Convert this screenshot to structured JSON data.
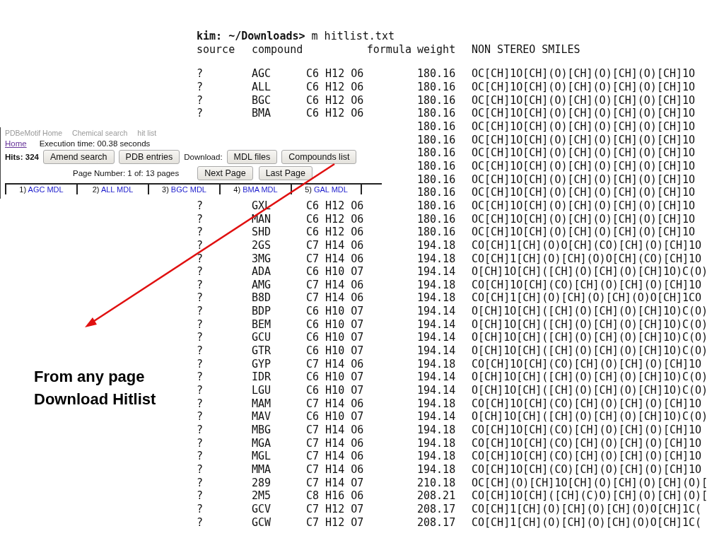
{
  "terminal": {
    "prompt": "**kim: ~/Downloads>** m hitlist.txt",
    "columns": [
      "source",
      "compound",
      "formula",
      "weight",
      "NON STEREO SMILES"
    ],
    "rows": [
      {
        "source": "?",
        "compound": "AGC",
        "formula": "C6 H12 O6",
        "weight": "180.16",
        "smiles": "OC[CH]1O[CH](O)[CH](O)[CH](O)[CH]1O"
      },
      {
        "source": "?",
        "compound": "ALL",
        "formula": "C6 H12 O6",
        "weight": "180.16",
        "smiles": "OC[CH]1O[CH](O)[CH](O)[CH](O)[CH]1O"
      },
      {
        "source": "?",
        "compound": "BGC",
        "formula": "C6 H12 O6",
        "weight": "180.16",
        "smiles": "OC[CH]1O[CH](O)[CH](O)[CH](O)[CH]1O"
      },
      {
        "source": "?",
        "compound": "BMA",
        "formula": "C6 H12 O6",
        "weight": "180.16",
        "smiles": "OC[CH]1O[CH](O)[CH](O)[CH](O)[CH]1O"
      },
      {
        "weight": "180.16",
        "smiles": "OC[CH]1O[CH](O)[CH](O)[CH](O)[CH]1O"
      },
      {
        "weight": "180.16",
        "smiles": "OC[CH]1O[CH](O)[CH](O)[CH](O)[CH]1O"
      },
      {
        "weight": "180.16",
        "smiles": "OC[CH]1O[CH](O)[CH](O)[CH](O)[CH]1O"
      },
      {
        "weight": "180.16",
        "smiles": "OC[CH]1O[CH](O)[CH](O)[CH](O)[CH]1O"
      },
      {
        "weight": "180.16",
        "smiles": "OC[CH]1O[CH](O)[CH](O)[CH](O)[CH]1O"
      },
      {
        "weight": "180.16",
        "smiles": "OC[CH]1O[CH](O)[CH](O)[CH](O)[CH]1O"
      },
      {
        "source": "?",
        "compound": "GXL",
        "formula": "C6 H12 O6",
        "weight": "180.16",
        "smiles": "OC[CH]1O[CH](O)[CH](O)[CH](O)[CH]1O"
      },
      {
        "source": "?",
        "compound": "MAN",
        "formula": "C6 H12 O6",
        "weight": "180.16",
        "smiles": "OC[CH]1O[CH](O)[CH](O)[CH](O)[CH]1O"
      },
      {
        "source": "?",
        "compound": "SHD",
        "formula": "C6 H12 O6",
        "weight": "180.16",
        "smiles": "OC[CH]1O[CH](O)[CH](O)[CH](O)[CH]1O"
      },
      {
        "source": "?",
        "compound": "2GS",
        "formula": "C7 H14 O6",
        "weight": "194.18",
        "smiles": "CO[CH]1[CH](O)O[CH](CO)[CH](O)[CH]1O"
      },
      {
        "source": "?",
        "compound": "3MG",
        "formula": "C7 H14 O6",
        "weight": "194.18",
        "smiles": "CO[CH]1[CH](O)[CH](O)O[CH](CO)[CH]1O"
      },
      {
        "source": "?",
        "compound": "ADA",
        "formula": "C6 H10 O7",
        "weight": "194.14",
        "smiles": "O[CH]1O[CH]([CH](O)[CH](O)[CH]1O)C(O)"
      },
      {
        "source": "?",
        "compound": "AMG",
        "formula": "C7 H14 O6",
        "weight": "194.18",
        "smiles": "CO[CH]1O[CH](CO)[CH](O)[CH](O)[CH]1O"
      },
      {
        "source": "?",
        "compound": "B8D",
        "formula": "C7 H14 O6",
        "weight": "194.18",
        "smiles": "CO[CH]1[CH](O)[CH](O)[CH](O)O[CH]1CO"
      },
      {
        "source": "?",
        "compound": "BDP",
        "formula": "C6 H10 O7",
        "weight": "194.14",
        "smiles": "O[CH]1O[CH]([CH](O)[CH](O)[CH]1O)C(O)"
      },
      {
        "source": "?",
        "compound": "BEM",
        "formula": "C6 H10 O7",
        "weight": "194.14",
        "smiles": "O[CH]1O[CH]([CH](O)[CH](O)[CH]1O)C(O)"
      },
      {
        "source": "?",
        "compound": "GCU",
        "formula": "C6 H10 O7",
        "weight": "194.14",
        "smiles": "O[CH]1O[CH]([CH](O)[CH](O)[CH]1O)C(O)"
      },
      {
        "source": "?",
        "compound": "GTR",
        "formula": "C6 H10 O7",
        "weight": "194.14",
        "smiles": "O[CH]1O[CH]([CH](O)[CH](O)[CH]1O)C(O)"
      },
      {
        "source": "?",
        "compound": "GYP",
        "formula": "C7 H14 O6",
        "weight": "194.18",
        "smiles": "CO[CH]1O[CH](CO)[CH](O)[CH](O)[CH]1O"
      },
      {
        "source": "?",
        "compound": "IDR",
        "formula": "C6 H10 O7",
        "weight": "194.14",
        "smiles": "O[CH]1O[CH]([CH](O)[CH](O)[CH]1O)C(O)"
      },
      {
        "source": "?",
        "compound": "LGU",
        "formula": "C6 H10 O7",
        "weight": "194.14",
        "smiles": "O[CH]1O[CH]([CH](O)[CH](O)[CH]1O)C(O)"
      },
      {
        "source": "?",
        "compound": "MAM",
        "formula": "C7 H14 O6",
        "weight": "194.18",
        "smiles": "CO[CH]1O[CH](CO)[CH](O)[CH](O)[CH]1O"
      },
      {
        "source": "?",
        "compound": "MAV",
        "formula": "C6 H10 O7",
        "weight": "194.14",
        "smiles": "O[CH]1O[CH]([CH](O)[CH](O)[CH]1O)C(O)"
      },
      {
        "source": "?",
        "compound": "MBG",
        "formula": "C7 H14 O6",
        "weight": "194.18",
        "smiles": "CO[CH]1O[CH](CO)[CH](O)[CH](O)[CH]1O"
      },
      {
        "source": "?",
        "compound": "MGA",
        "formula": "C7 H14 O6",
        "weight": "194.18",
        "smiles": "CO[CH]1O[CH](CO)[CH](O)[CH](O)[CH]1O"
      },
      {
        "source": "?",
        "compound": "MGL",
        "formula": "C7 H14 O6",
        "weight": "194.18",
        "smiles": "CO[CH]1O[CH](CO)[CH](O)[CH](O)[CH]1O"
      },
      {
        "source": "?",
        "compound": "MMA",
        "formula": "C7 H14 O6",
        "weight": "194.18",
        "smiles": "CO[CH]1O[CH](CO)[CH](O)[CH](O)[CH]1O"
      },
      {
        "source": "?",
        "compound": "289",
        "formula": "C7 H14 O7",
        "weight": "210.18",
        "smiles": "OC[CH](O)[CH]1O[CH](O)[CH](O)[CH](O)["
      },
      {
        "source": "?",
        "compound": "2M5",
        "formula": "C8 H16 O6",
        "weight": "208.21",
        "smiles": "CO[CH]1O[CH]([CH](C)O)[CH](O)[CH](O)["
      },
      {
        "source": "?",
        "compound": "GCV",
        "formula": "C7 H12 O7",
        "weight": "208.17",
        "smiles": "CO[CH]1[CH](O)[CH](O)[CH](O)O[CH]1C("
      },
      {
        "source": "?",
        "compound": "GCW",
        "formula": "C7 H12 O7",
        "weight": "208.17",
        "smiles": "CO[CH]1[CH](O)[CH](O)[CH](O)O[CH]1C("
      }
    ]
  },
  "web_page": {
    "breadcrumbs": [
      "PDBeMotif Home",
      "Chemical search",
      "hit list"
    ],
    "home_link": "Home",
    "execution_time": "Execution time: 00.38 seconds",
    "hits": "Hits: 324",
    "buttons": [
      "Amend search",
      "PDB entries"
    ],
    "download_label": "Download:",
    "download_buttons": [
      "MDL files",
      "Compounds list"
    ],
    "page_number": "Page Number: 1 of: 13 pages",
    "nav_buttons": [
      "Next Page",
      "Last Page"
    ],
    "results": [
      {
        "number": "1)",
        "link": "AGC MDL"
      },
      {
        "number": "2)",
        "link": "ALL MDL"
      },
      {
        "number": "3)",
        "link": "BGC MDL"
      },
      {
        "number": "4)",
        "link": "BMA MDL"
      },
      {
        "number": "5)",
        "link": "GAL MDL"
      }
    ]
  },
  "caption": [
    "From any page",
    "Download Hitlist"
  ]
}
